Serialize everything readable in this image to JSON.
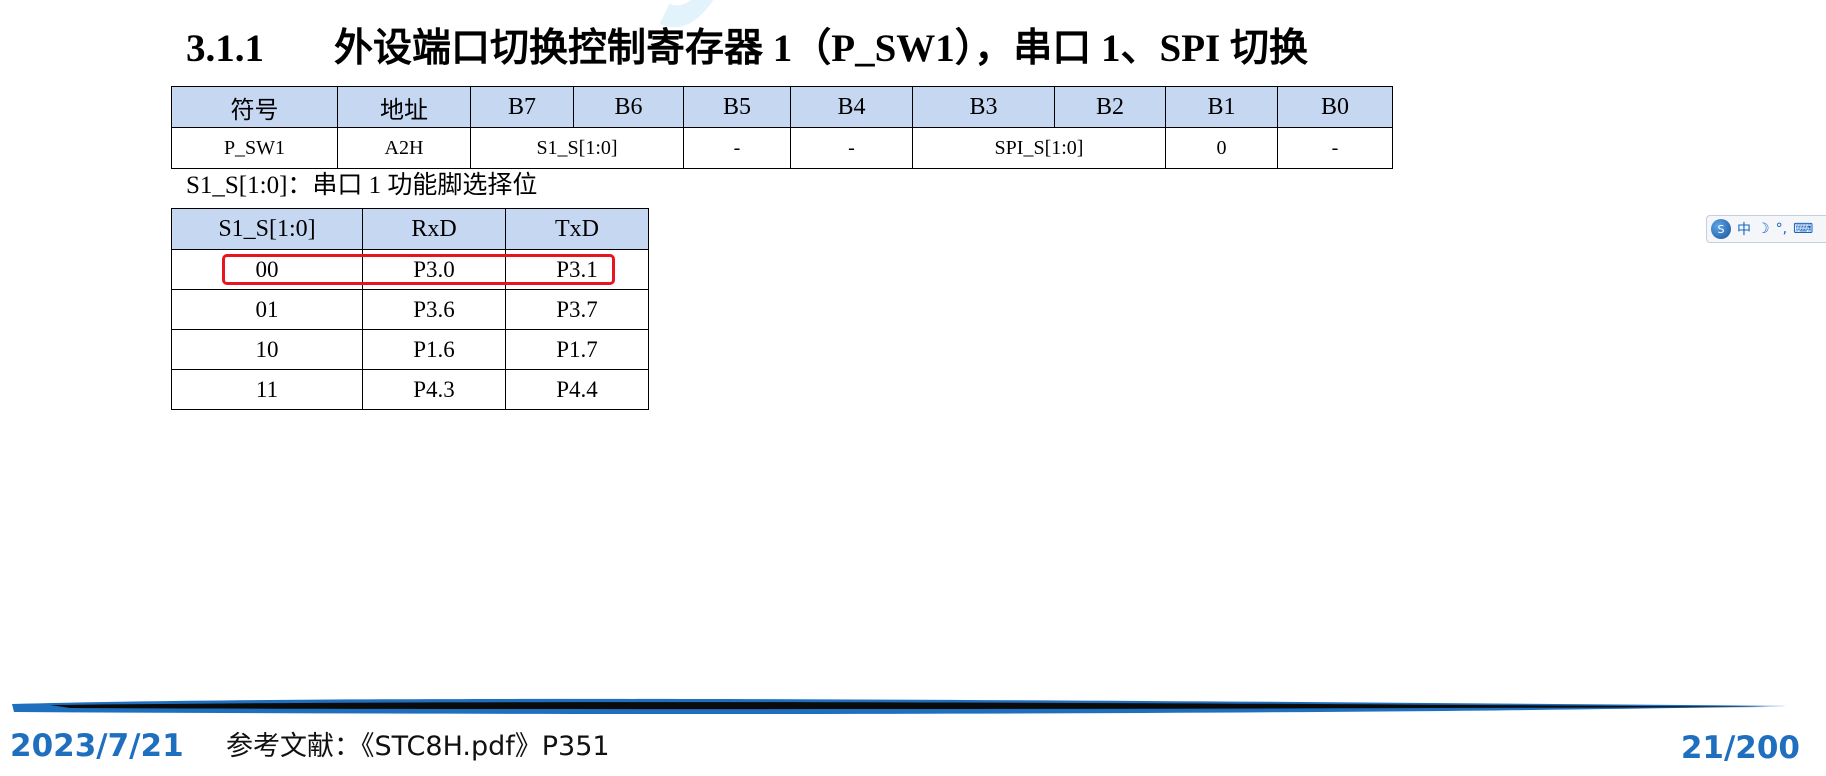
{
  "watermark": "STC",
  "heading": {
    "number": "3.1.1",
    "text": "外设端口切换控制寄存器 1（P_SW1），串口 1、SPI 切换"
  },
  "register_table": {
    "headers": [
      "符号",
      "地址",
      "B7",
      "B6",
      "B5",
      "B4",
      "B3",
      "B2",
      "B1",
      "B0"
    ],
    "row": {
      "symbol": "P_SW1",
      "address": "A2H",
      "b7_b6": "S1_S[1:0]",
      "b5": "-",
      "b4": "-",
      "b3_b2": "SPI_S[1:0]",
      "b1": "0",
      "b0": "-"
    }
  },
  "select_caption": "S1_S[1:0]：串口 1 功能脚选择位",
  "pin_table": {
    "headers": [
      "S1_S[1:0]",
      "RxD",
      "TxD"
    ],
    "rows": [
      [
        "00",
        "P3.0",
        "P3.1"
      ],
      [
        "01",
        "P3.6",
        "P3.7"
      ],
      [
        "10",
        "P1.6",
        "P1.7"
      ],
      [
        "11",
        "P4.3",
        "P4.4"
      ]
    ],
    "highlight_color": "#e8141e"
  },
  "ime_toolbar": {
    "logo_icon": "sogou-logo-icon",
    "mode": "中"
  },
  "footer": {
    "date": "2023/7/21",
    "reference": "参考文献：《STC8H.pdf》P351",
    "page": "21/200",
    "accent_color": "#1f6fbf"
  }
}
